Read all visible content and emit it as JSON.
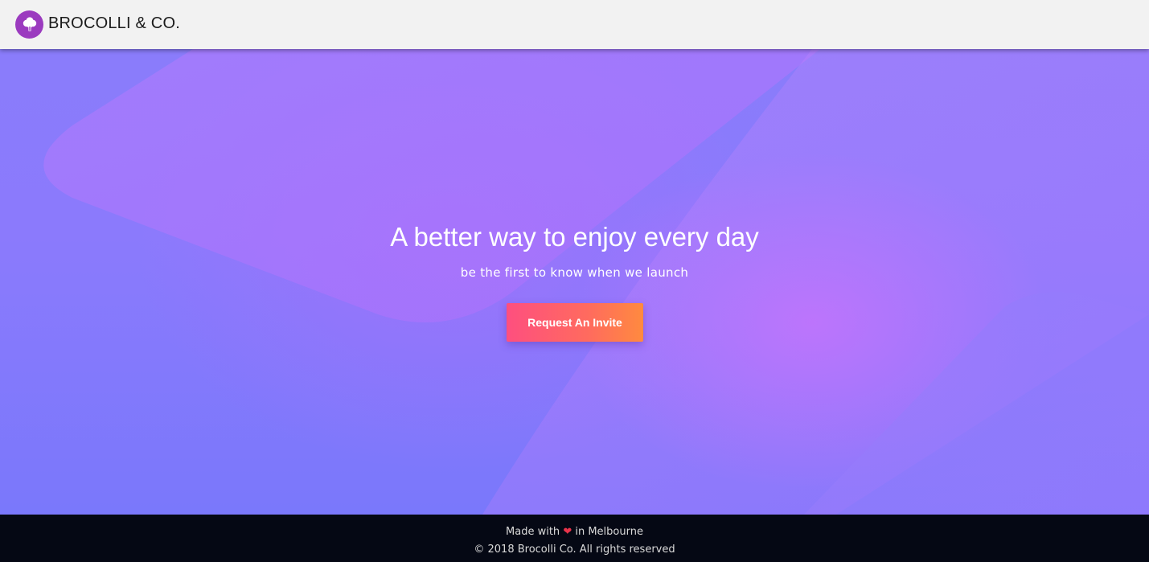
{
  "header": {
    "brand": "BROCOLLI & CO.",
    "logo_icon": "broccoli-icon"
  },
  "hero": {
    "title": "A better way to enjoy every day",
    "subtitle": "be the first to know when we launch",
    "cta_label": "Request An Invite"
  },
  "footer": {
    "made_with_prefix": "Made with",
    "heart_glyph": "❤",
    "made_with_suffix": "in Melbourne",
    "copyright": "© 2018 Brocolli Co. All rights reserved"
  },
  "colors": {
    "header_bg": "#f2f2f2",
    "logo_bg": "#9b3bbf",
    "hero_base": "#7a78fb",
    "hero_glow": "#bf70fc",
    "cta_start": "#fe4f7f",
    "cta_end": "#ff8a3f",
    "footer_bg": "#050814",
    "heart": "#e8334a"
  }
}
